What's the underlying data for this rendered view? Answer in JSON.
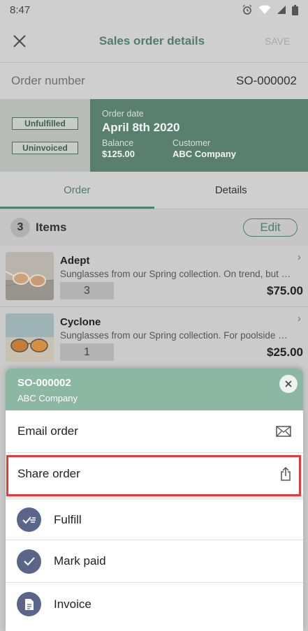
{
  "status_bar": {
    "time": "8:47"
  },
  "app_bar": {
    "title": "Sales order details",
    "save_label": "SAVE"
  },
  "order": {
    "number_label": "Order number",
    "number_value": "SO-000002"
  },
  "summary": {
    "badges": [
      "Unfulfilled",
      "Uninvoiced"
    ],
    "order_date_label": "Order date",
    "order_date": "April 8th 2020",
    "balance_label": "Balance",
    "balance": "$125.00",
    "customer_label": "Customer",
    "customer": "ABC Company"
  },
  "tabs": [
    {
      "label": "Order",
      "active": true
    },
    {
      "label": "Details",
      "active": false
    }
  ],
  "items_header": {
    "count": "3",
    "label": "Items",
    "edit_label": "Edit"
  },
  "items": [
    {
      "name": "Adept",
      "description": "Sunglasses from our Spring collection. On trend, but wi...",
      "qty": "3",
      "price": "$75.00"
    },
    {
      "name": "Cyclone",
      "description": "Sunglasses from our Spring collection. For poolside or...",
      "qty": "1",
      "price": "$25.00"
    }
  ],
  "sheet": {
    "title": "SO-000002",
    "subtitle": "ABC Company",
    "actions": [
      {
        "label": "Email order",
        "icon": "mail-icon"
      },
      {
        "label": "Share order",
        "icon": "share-icon"
      },
      {
        "label": "Fulfill",
        "icon": "fulfill-icon"
      },
      {
        "label": "Mark paid",
        "icon": "check-icon"
      },
      {
        "label": "Invoice",
        "icon": "document-icon"
      }
    ],
    "highlight_color": "#e33a3a"
  },
  "colors": {
    "accent": "#4f7d6c",
    "sheet_header": "#8cb7a3",
    "action_icon": "#5a6589"
  }
}
